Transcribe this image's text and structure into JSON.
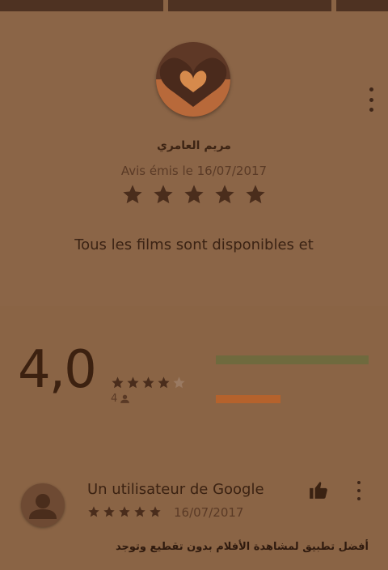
{
  "featured_review": {
    "reviewer_name": "مريم العامري",
    "date_line": "Avis émis le 16/07/2017",
    "stars": 5,
    "text": "Tous les films sont disponibles et"
  },
  "rating_summary": {
    "average": "4,0",
    "count": "4",
    "stars_filled": 4,
    "distribution": [
      {
        "level": 5,
        "fraction": 1.0,
        "color": "#6f6a3e"
      },
      {
        "level": 1,
        "fraction": 0.42,
        "color": "#b5622c"
      }
    ]
  },
  "review": {
    "author": "Un utilisateur de Google",
    "stars": 5,
    "date": "16/07/2017",
    "text": "أفضل تطبيق لمشاهدة الأفلام بدون تقطيع وتوجد"
  },
  "icons": {
    "more": "more-vert-icon",
    "thumb": "thumb-up-icon",
    "person": "person-icon",
    "star": "star-icon"
  },
  "colors": {
    "background": "#8a6445",
    "text": "#3b2212",
    "star": "#4a2d1c",
    "star_empty": "#9a7a62"
  }
}
